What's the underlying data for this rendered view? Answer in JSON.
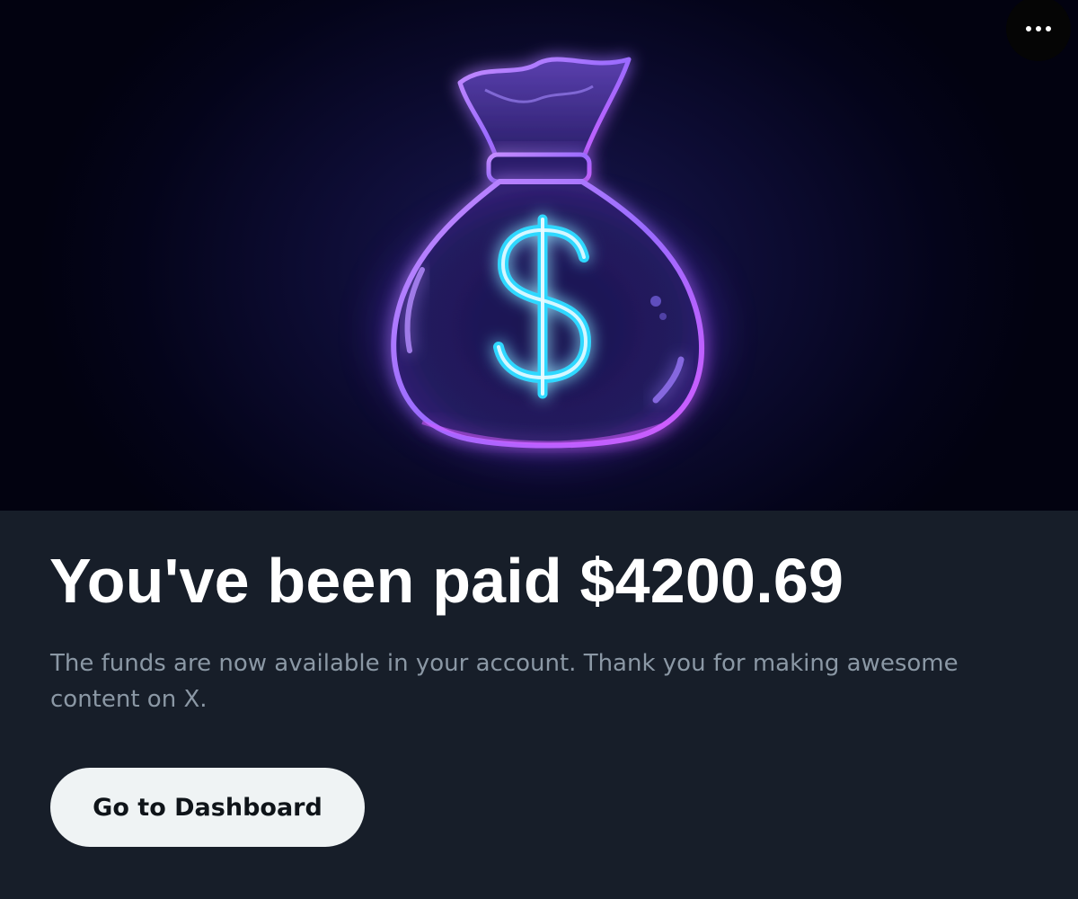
{
  "hero": {
    "icon": "money-bag-icon",
    "dollar_glyph": "$",
    "more_menu_icon": "more-horizontal-icon",
    "colors": {
      "background": "#0a0a2a",
      "outline_purple": "#b06cff",
      "dollar_cyan": "#2fd8ff"
    }
  },
  "content": {
    "title": "You've been paid $4200.69",
    "description": "The funds are now available in your account. Thank you for making awesome content on X.",
    "button_label": "Go to Dashboard"
  },
  "colors": {
    "panel_background": "#171e29",
    "title_text": "#ffffff",
    "description_text": "#8b98a5",
    "button_background": "#eff3f4",
    "button_text": "#0f1419"
  }
}
